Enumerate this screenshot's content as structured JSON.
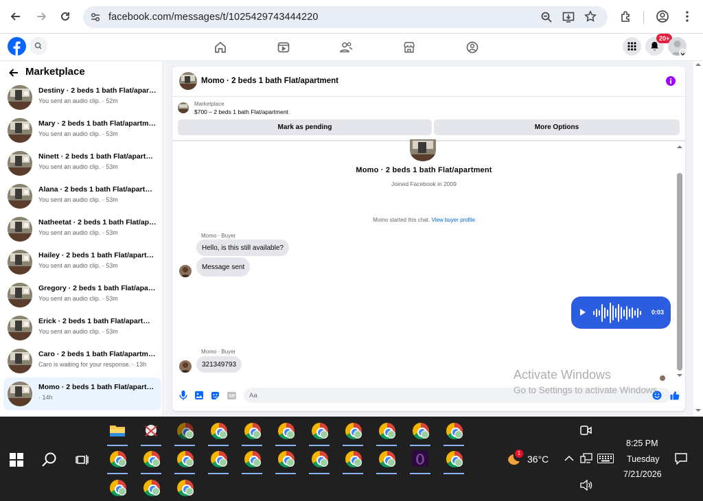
{
  "browser": {
    "url": "facebook.com/messages/t/1025429743444220"
  },
  "fb": {
    "notif_badge": "20+"
  },
  "sidebar": {
    "title": "Marketplace",
    "chats": [
      {
        "name": "Destiny · 2 beds 1 bath Flat/apart...",
        "sub": "You sent an audio clip. · 52m"
      },
      {
        "name": "Mary · 2 beds 1 bath Flat/apartment",
        "sub": "You sent an audio clip. · 53m"
      },
      {
        "name": "Ninett · 2 beds 1 bath Flat/apartm...",
        "sub": "You sent an audio clip. · 53m"
      },
      {
        "name": "Alana · 2 beds 1 bath Flat/apartment",
        "sub": "You sent an audio clip. · 53m"
      },
      {
        "name": "Natheetat · 2 beds 1 bath Flat/apar...",
        "sub": "You sent an audio clip. · 53m"
      },
      {
        "name": "Hailey · 2 beds 1 bath Flat/apartm...",
        "sub": "You sent an audio clip. · 53m"
      },
      {
        "name": "Gregory · 2 beds 1 bath Flat/apart...",
        "sub": "You sent an audio clip. · 53m"
      },
      {
        "name": "Erick · 2 beds 1 bath Flat/apartment",
        "sub": "You sent an audio clip. · 53m"
      },
      {
        "name": "Caro · 2 beds 1 bath Flat/apartment",
        "sub": "Caro is waiting for your response. · 13h"
      },
      {
        "name": "Momo · 2 beds 1 bath Flat/apartm...",
        "sub": "· 14h"
      }
    ]
  },
  "chat": {
    "header_title": "Momo · 2 beds 1 bath Flat/apartment",
    "listing_source": "Marketplace",
    "listing_price": "$700 – 2 beds 1 bath Flat/apartment",
    "mark_pending": "Mark as pending",
    "more_options": "More Options",
    "profile_name": "Momo · 2 beds 1 bath Flat/apartment",
    "joined": "Joined Facebook in 2009",
    "started_text": "Momo started this chat.",
    "view_buyer": "View buyer profile",
    "sender_label_1": "Momo · Buyer",
    "msg1": "Hello, is this still available?",
    "msg2": "Message sent",
    "audio_duration": "0:03",
    "sender_label_2": "Momo · Buyer",
    "msg3": "321349793",
    "input_placeholder": "Aa"
  },
  "watermark": {
    "line1": "Activate Windows",
    "line2": "Go to Settings to activate Windows."
  },
  "taskbar": {
    "weather_temp": "36°C",
    "weather_badge": "1",
    "time": "8:25 PM",
    "day": "Tuesday",
    "date": "7/21/2026"
  },
  "colors": {
    "fb_blue": "#0866ff",
    "audio_bubble": "#2b5de0",
    "taskbar": "#202020",
    "info_purple": "#a200ff"
  }
}
